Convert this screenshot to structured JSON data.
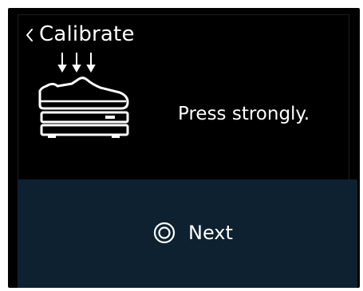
{
  "header": {
    "title": "Calibrate",
    "back_icon": "chevron-left-icon"
  },
  "main": {
    "illustration_icon": "shoe-on-scale-icon",
    "instruction": "Press strongly."
  },
  "footer": {
    "next_label": "Next",
    "next_icon": "double-circle-icon",
    "background_color": "#0d2130"
  }
}
